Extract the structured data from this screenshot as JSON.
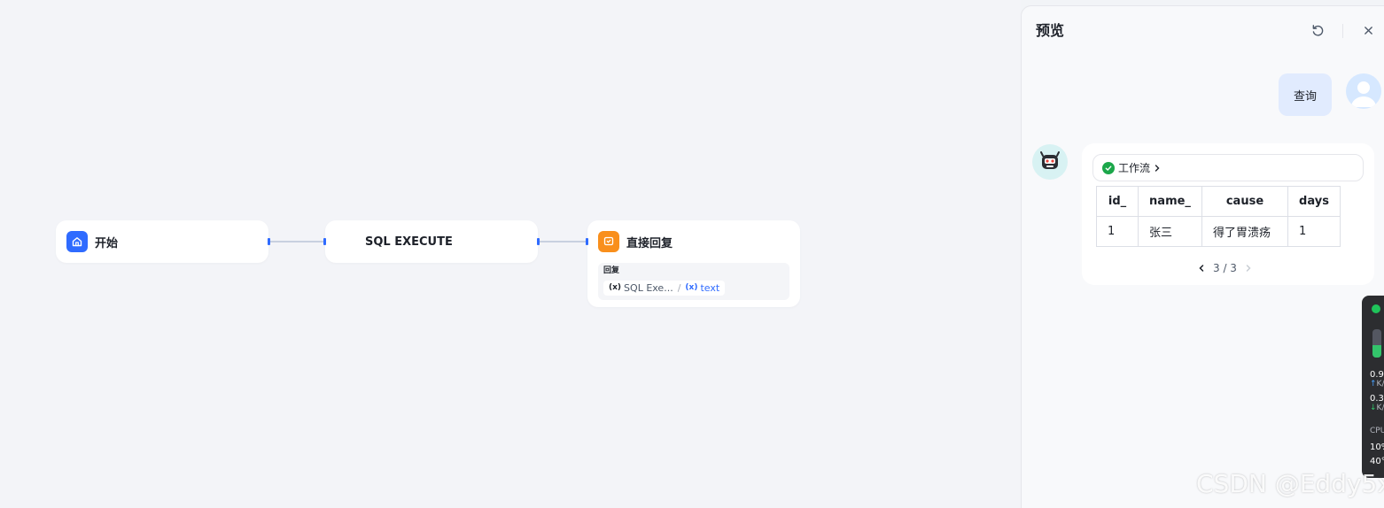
{
  "workflow": {
    "nodes": [
      {
        "id": "start",
        "title": "开始"
      },
      {
        "id": "sql",
        "title": "SQL EXECUTE"
      },
      {
        "id": "reply",
        "title": "直接回复",
        "field_label": "回复",
        "var_symbol": "(x)",
        "var_source": "SQL Exe...",
        "var_sep": "/",
        "var_name": "text"
      }
    ]
  },
  "preview": {
    "title": "预览",
    "user_message": "查询",
    "workflow_label": "工作流",
    "table": {
      "headers": [
        "id_",
        "name_",
        "cause",
        "days"
      ],
      "rows": [
        [
          "1",
          "张三",
          "得了胃溃疡",
          "1"
        ]
      ]
    },
    "pager": {
      "text": "3 / 3"
    }
  },
  "monitor": {
    "net_up_value": "0.9",
    "net_up_unit": "K/",
    "net_down_value": "0.3",
    "net_down_unit": "K/",
    "cpu_label": "CPU",
    "cpu_value": "10%",
    "temp_value": "40°",
    "memory_level_percent": 45
  },
  "watermark": "CSDN @Eddy5x",
  "colors": {
    "accent": "#2f6bff",
    "start_icon": "#2f6bff",
    "reply_icon": "#f98f1c",
    "success": "#1ba74a"
  }
}
